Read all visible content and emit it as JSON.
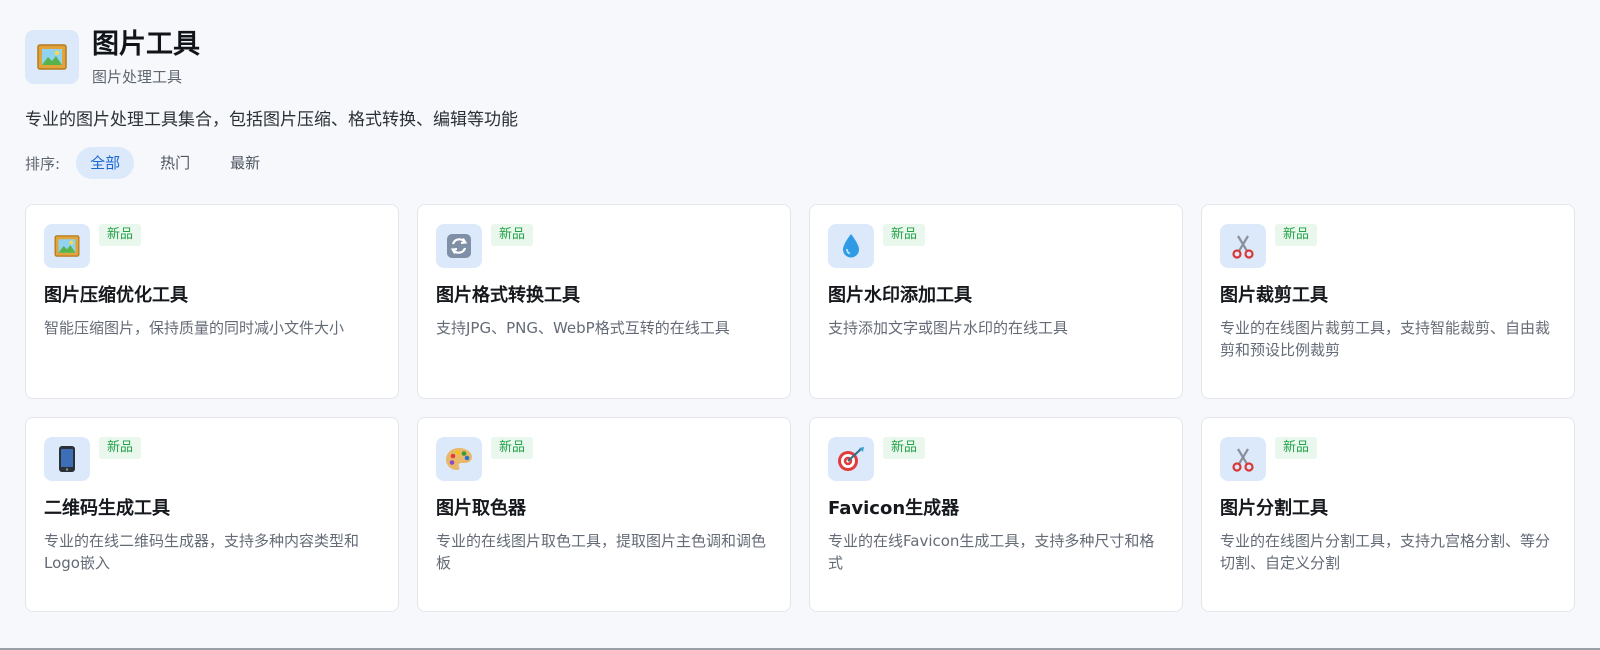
{
  "header": {
    "icon": "framed-picture-icon",
    "title": "图片工具",
    "subtitle": "图片处理工具"
  },
  "description": "专业的图片处理工具集合，包括图片压缩、格式转换、编辑等功能",
  "sort": {
    "label": "排序:",
    "options": [
      {
        "label": "全部",
        "active": true
      },
      {
        "label": "热门",
        "active": false
      },
      {
        "label": "最新",
        "active": false
      }
    ]
  },
  "tools": [
    {
      "icon": "framed-picture-icon",
      "badge": "新品",
      "title": "图片压缩优化工具",
      "description": "智能压缩图片，保持质量的同时减小文件大小"
    },
    {
      "icon": "refresh-arrows-icon",
      "badge": "新品",
      "title": "图片格式转换工具",
      "description": "支持JPG、PNG、WebP格式互转的在线工具"
    },
    {
      "icon": "water-drop-icon",
      "badge": "新品",
      "title": "图片水印添加工具",
      "description": "支持添加文字或图片水印的在线工具"
    },
    {
      "icon": "scissors-icon",
      "badge": "新品",
      "title": "图片裁剪工具",
      "description": "专业的在线图片裁剪工具，支持智能裁剪、自由裁剪和预设比例裁剪"
    },
    {
      "icon": "mobile-phone-icon",
      "badge": "新品",
      "title": "二维码生成工具",
      "description": "专业的在线二维码生成器，支持多种内容类型和Logo嵌入"
    },
    {
      "icon": "artist-palette-icon",
      "badge": "新品",
      "title": "图片取色器",
      "description": "专业的在线图片取色工具，提取图片主色调和调色板"
    },
    {
      "icon": "target-dart-icon",
      "badge": "新品",
      "title": "Favicon生成器",
      "description": "专业的在线Favicon生成工具，支持多种尺寸和格式"
    },
    {
      "icon": "scissors-icon",
      "badge": "新品",
      "title": "图片分割工具",
      "description": "专业的在线图片分割工具，支持九宫格分割、等分切割、自定义分割"
    }
  ]
}
